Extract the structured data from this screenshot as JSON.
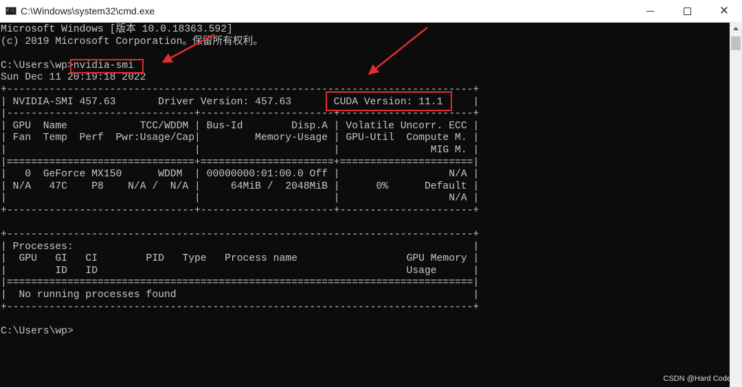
{
  "window": {
    "title": "C:\\Windows\\system32\\cmd.exe",
    "icon": "cmd-console-icon"
  },
  "console": {
    "lines": [
      "Microsoft Windows [版本 10.0.18363.592]",
      "(c) 2019 Microsoft Corporation。保留所有权利。",
      "",
      "C:\\Users\\wp>nvidia-smi",
      "Sun Dec 11 20:19:18 2022",
      "+-----------------------------------------------------------------------------+",
      "| NVIDIA-SMI 457.63       Driver Version: 457.63       CUDA Version: 11.1     |",
      "|-------------------------------+----------------------+----------------------+",
      "| GPU  Name            TCC/WDDM | Bus-Id        Disp.A | Volatile Uncorr. ECC |",
      "| Fan  Temp  Perf  Pwr:Usage/Cap|         Memory-Usage | GPU-Util  Compute M. |",
      "|                               |                      |               MIG M. |",
      "|===============================+======================+======================|",
      "|   0  GeForce MX150      WDDM  | 00000000:01:00.0 Off |                  N/A |",
      "| N/A   47C    P8    N/A /  N/A |     64MiB /  2048MiB |      0%      Default |",
      "|                               |                      |                  N/A |",
      "+-------------------------------+----------------------+----------------------+",
      "",
      "+-----------------------------------------------------------------------------+",
      "| Processes:                                                                  |",
      "|  GPU   GI   CI        PID   Type   Process name                  GPU Memory |",
      "|        ID   ID                                                   Usage      |",
      "|=============================================================================|",
      "|  No running processes found                                                 |",
      "+-----------------------------------------------------------------------------+",
      "",
      "C:\\Users\\wp>"
    ]
  },
  "watermark": "CSDN @Hard Code",
  "annotation_color": "#e32c2c"
}
